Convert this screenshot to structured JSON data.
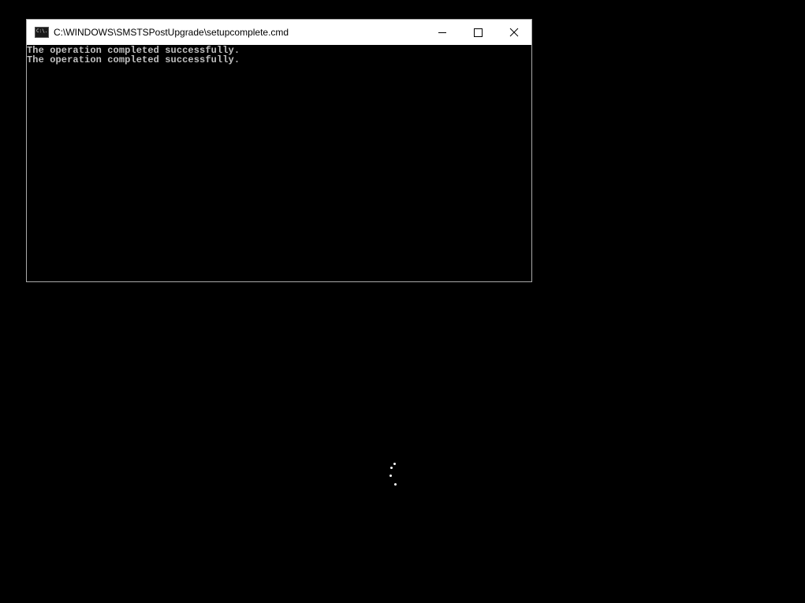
{
  "window": {
    "title": "C:\\WINDOWS\\SMSTSPostUpgrade\\setupcomplete.cmd",
    "icon": "cmd-icon",
    "controls": {
      "minimize": "minimize-icon",
      "maximize": "maximize-icon",
      "close": "close-icon"
    }
  },
  "console": {
    "lines": [
      "The operation completed successfully.",
      "The operation completed successfully."
    ]
  },
  "spinner": {
    "icon": "loading-spinner-icon"
  }
}
